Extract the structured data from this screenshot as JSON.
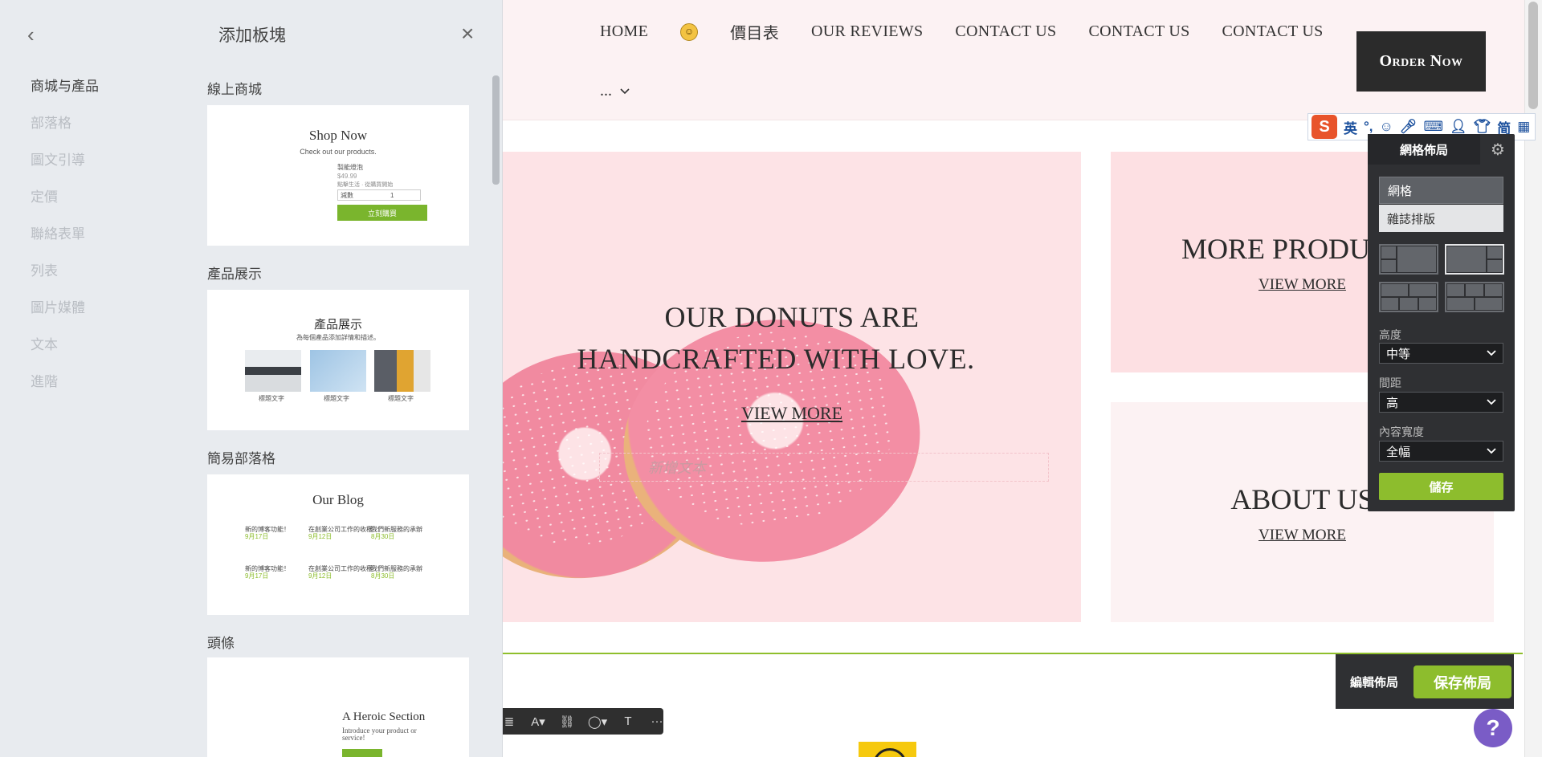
{
  "panel": {
    "title": "添加板塊",
    "categories": [
      {
        "label": "商城与產品",
        "active": true
      },
      {
        "label": "部落格"
      },
      {
        "label": "圖文引導"
      },
      {
        "label": "定價"
      },
      {
        "label": "聯絡表單"
      },
      {
        "label": "列表"
      },
      {
        "label": "圖片媒體"
      },
      {
        "label": "文本"
      },
      {
        "label": "進階"
      }
    ],
    "blocks": [
      {
        "label": "線上商城",
        "title": "Shop Now",
        "subtitle": "Check out our products.",
        "product_name": "製能燈泡",
        "price": "$49.99",
        "desc": "點擊生活 · 從購買開始",
        "qty_label": "減數",
        "qty_value": "1",
        "button": "立刻購買"
      },
      {
        "label": "產品展示",
        "title": "產品展示",
        "subtitle": "為每個產品添加詳情和描述。",
        "items": [
          "標題文字",
          "標題文字",
          "標題文字"
        ]
      },
      {
        "label": "簡易部落格",
        "title": "Our Blog",
        "posts": [
          {
            "title": "新的博客功能！",
            "date": "9月17日"
          },
          {
            "title": "在創業公司工作的收穫",
            "date": "9月12日"
          },
          {
            "title": "我們新服務的承辦",
            "date": "8月30日"
          },
          {
            "title": "新的博客功能！",
            "date": "9月17日"
          },
          {
            "title": "在創業公司工作的收穫",
            "date": "9月12日"
          },
          {
            "title": "我們新服務的承辦",
            "date": "8月30日"
          }
        ]
      },
      {
        "label": "頭條",
        "title": "A Heroic Section",
        "subtitle": "Introduce your product or service!"
      }
    ]
  },
  "site": {
    "nav": {
      "items": [
        "HOME",
        "價目表",
        "OUR REVIEWS",
        "CONTACT US",
        "CONTACT US",
        "CONTACT US"
      ],
      "smiley": "☺",
      "more": "..."
    },
    "order_button": "Order Now",
    "hero": {
      "line1": "OUR DONUTS ARE",
      "line2": "HANDCRAFTED WITH LOVE.",
      "link": "VIEW MORE",
      "placeholder": "新增文本"
    },
    "card1": {
      "title": "MORE PRODUCTS",
      "link": "VIEW MORE"
    },
    "card2": {
      "title": "ABOUT US",
      "link": "VIEW MORE"
    }
  },
  "ime": {
    "logo": "S",
    "lang": "英",
    "mode": "简"
  },
  "grid_panel": {
    "title": "網格佈局",
    "options": [
      "網格",
      "雜誌排版"
    ],
    "height_label": "高度",
    "height_value": "中等",
    "spacing_label": "間距",
    "spacing_value": "高",
    "width_label": "內容寬度",
    "width_value": "全幅",
    "save": "儲存"
  },
  "edit_bar": {
    "label": "編輯佈局",
    "save": "保存佈局"
  },
  "help": "?",
  "colors": {
    "accent_green": "#8dbd2d",
    "dark_panel": "#2f3033",
    "hero_pink": "#fde3e6",
    "help_purple": "#7a5cc6"
  }
}
